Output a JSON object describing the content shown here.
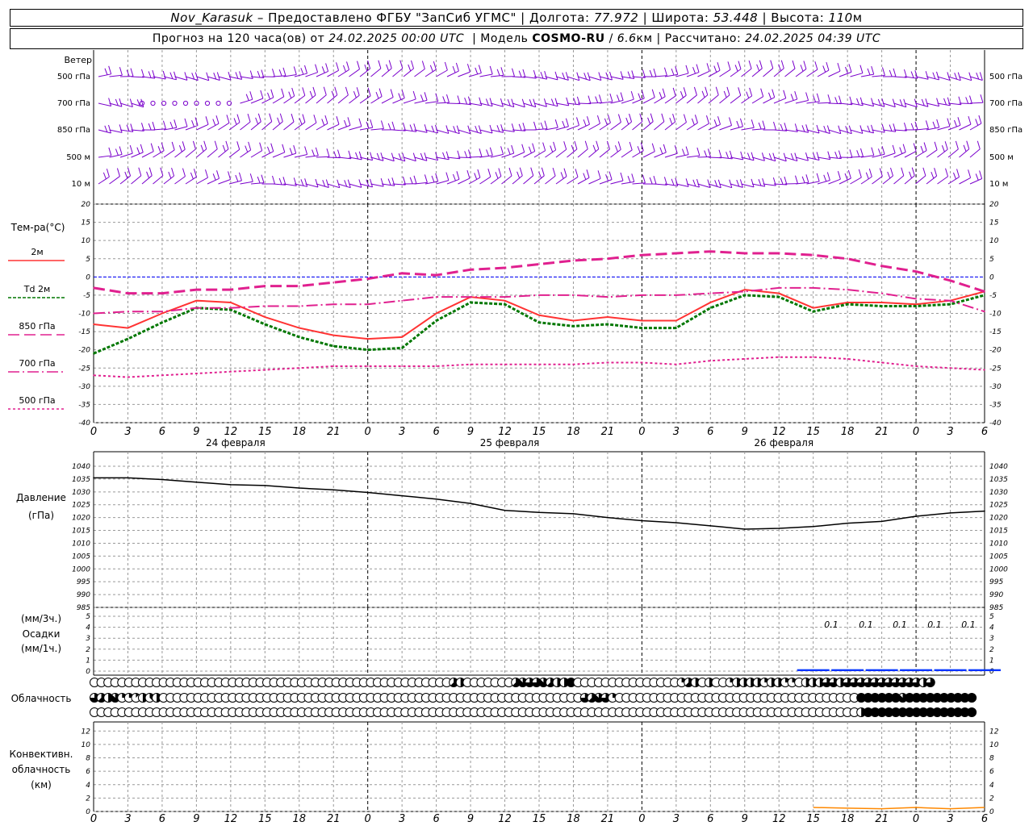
{
  "header": {
    "station": "Nov_Karasuk",
    "provided": "– Предоставлено ФГБУ \"ЗапСиб УГМС\"",
    "lon_label": "Долгота:",
    "lon": "77.972",
    "lat_label": "Широта:",
    "lat": "53.448",
    "alt_label": "Высота:",
    "alt": "110",
    "alt_unit": "м",
    "forecast_label": "Прогноз на 120 часа(ов) от",
    "forecast_time": "24.02.2025 00:00 UTC",
    "model_label": "Модель",
    "model": "COSMO-RU",
    "resolution": "6.6",
    "resolution_unit": "км",
    "computed_label": "Рассчитано:",
    "computed_time": "24.02.2025 04:39 UTC"
  },
  "wind_panel": {
    "title": "Ветер",
    "levels": [
      "500 гПа",
      "700 гПа",
      "850 гПа",
      "500 м",
      "10 м"
    ]
  },
  "temp_panel": {
    "title": "Тем-ра(°C)",
    "legend": [
      {
        "label": "2м",
        "color": "#ff3333",
        "dash": ""
      },
      {
        "label": "Td 2м",
        "color": "#007700",
        "dash": "4,2"
      },
      {
        "label": "850 гПа",
        "color": "#e0208f",
        "dash": "14,6"
      },
      {
        "label": "700 гПа",
        "color": "#e0208f",
        "dash": "14,4,2,4"
      },
      {
        "label": "500 гПа",
        "color": "#e0208f",
        "dash": "3,3"
      }
    ],
    "yticks": [
      "20",
      "15",
      "10",
      "5",
      "0",
      "-5",
      "-10",
      "-15",
      "-20",
      "-25",
      "-30",
      "-35",
      "-40"
    ]
  },
  "pressure_panel": {
    "title": "Давление",
    "unit": "(гПа)",
    "yticks": [
      "1040",
      "1035",
      "1030",
      "1025",
      "1020",
      "1015",
      "1010",
      "1005",
      "1000",
      "995",
      "990",
      "985"
    ]
  },
  "precip_panel": {
    "unit3": "(мм/3ч.)",
    "title": "Осадки",
    "unit1": "(мм/1ч.)",
    "yticks": [
      "5",
      "4",
      "3",
      "2",
      "1",
      "0"
    ],
    "labels": [
      "0.1",
      "0.1",
      "0.1",
      "0.1",
      "0.1"
    ]
  },
  "cloud_panel": {
    "title": "Облачность"
  },
  "conv_panel": {
    "title1": "Конвективн.",
    "title2": "облачность",
    "unit": "(км)",
    "yticks": [
      "12",
      "10",
      "8",
      "6",
      "4",
      "2",
      "0"
    ]
  },
  "time_axis": {
    "hour_labels": [
      "0",
      "3",
      "6",
      "9",
      "12",
      "15",
      "18",
      "21",
      "0",
      "3",
      "6",
      "9",
      "12",
      "15",
      "18",
      "21",
      "0",
      "3",
      "6",
      "9",
      "12",
      "15",
      "18",
      "21",
      "0",
      "3",
      "6"
    ],
    "dates": [
      "24 февраля",
      "25 февраля",
      "26 февраля"
    ]
  },
  "colors": {
    "wind": "#7a00cc",
    "zero_line": "#0000ff",
    "precip": "#0033ff",
    "conv": "#ff8800"
  },
  "chart_data": [
    {
      "type": "line",
      "title": "Тем-ра(°C)",
      "x_hours": [
        0,
        3,
        6,
        9,
        12,
        15,
        18,
        21,
        24,
        27,
        30,
        33,
        36,
        39,
        42,
        45,
        48,
        51,
        54,
        57,
        60,
        63,
        66,
        69,
        72,
        75,
        78
      ],
      "ylim": [
        -40,
        20
      ],
      "series": [
        {
          "name": "2м",
          "values": [
            -13,
            -14,
            -10,
            -6.5,
            -7,
            -11,
            -14,
            -16,
            -17,
            -16.5,
            -10,
            -5.5,
            -6.5,
            -10.5,
            -12,
            -11,
            -12,
            -12,
            -7,
            -3.5,
            -4.5,
            -8.5,
            -7,
            -7,
            -7.5,
            -6.5,
            -4
          ]
        },
        {
          "name": "Td 2м",
          "values": [
            -21,
            -17,
            -12.5,
            -8.5,
            -9,
            -13,
            -16.5,
            -19,
            -20,
            -19.5,
            -12,
            -7,
            -7.5,
            -12.5,
            -13.5,
            -13,
            -14,
            -14,
            -8.5,
            -5,
            -5.5,
            -9.5,
            -7.5,
            -8,
            -8,
            -7.5,
            -5
          ]
        },
        {
          "name": "850 гПа",
          "values": [
            -3,
            -4.5,
            -4.5,
            -3.5,
            -3.5,
            -2.5,
            -2.5,
            -1.5,
            -0.5,
            1,
            0.5,
            2,
            2.5,
            3.5,
            4.5,
            5,
            6,
            6.5,
            7,
            6.5,
            6.5,
            6,
            5,
            3,
            1.5,
            -1,
            -4
          ]
        },
        {
          "name": "700 гПа",
          "values": [
            -10,
            -9.5,
            -9.5,
            -8.5,
            -8.5,
            -8,
            -8,
            -7.5,
            -7.5,
            -6.5,
            -5.5,
            -5.5,
            -5.5,
            -5,
            -5,
            -5.5,
            -5,
            -5,
            -4.5,
            -4,
            -3,
            -3,
            -3.5,
            -4.5,
            -6,
            -6.5,
            -9.5
          ]
        },
        {
          "name": "500 гПа",
          "values": [
            -27,
            -27.5,
            -27,
            -26.5,
            -26,
            -25.5,
            -25,
            -24.5,
            -24.5,
            -24.5,
            -24.5,
            -24,
            -24,
            -24,
            -24,
            -23.5,
            -23.5,
            -24,
            -23,
            -22.5,
            -22,
            -22,
            -22.5,
            -23.5,
            -24.5,
            -25,
            -25.5
          ]
        }
      ]
    },
    {
      "type": "line",
      "title": "Давление",
      "x_hours": [
        0,
        3,
        6,
        9,
        12,
        15,
        18,
        21,
        24,
        27,
        30,
        33,
        36,
        39,
        42,
        45,
        48,
        51,
        54,
        57,
        60,
        63,
        66,
        69,
        72,
        75,
        78
      ],
      "ylim": [
        985,
        1040
      ],
      "series": [
        {
          "name": "",
          "values": [
            1035.5,
            1035.5,
            1034.8,
            1033.8,
            1032.8,
            1032.5,
            1031.5,
            1030.8,
            1029.8,
            1028.5,
            1027.2,
            1025.5,
            1022.8,
            1022,
            1021.5,
            1020,
            1018.8,
            1018,
            1016.8,
            1015.5,
            1015.8,
            1016.5,
            1017.8,
            1018.5,
            1020.5,
            1021.8,
            1022.5
          ]
        }
      ]
    },
    {
      "type": "bar",
      "title": "Осадки",
      "x_hours": [
        48,
        51,
        54,
        57,
        60,
        63,
        66,
        69,
        72,
        75,
        78
      ],
      "values": [
        0,
        0,
        0,
        0,
        0,
        0.1,
        0.1,
        0.1,
        0.1,
        0.1,
        0.1
      ],
      "ylim": [
        0,
        5
      ]
    },
    {
      "type": "area",
      "title": "Конвективн. облачность",
      "x_hours": [
        63,
        66,
        69,
        72,
        75,
        78
      ],
      "values": [
        0.6,
        0.5,
        0.4,
        0.6,
        0.4,
        0.6
      ],
      "ylim": [
        0,
        13
      ]
    },
    {
      "type": "table",
      "title": "Облачность",
      "rows": [
        {
          "level": "upper",
          "octas": [
            0,
            0,
            0,
            0,
            0,
            0,
            0,
            0,
            0,
            0,
            0,
            0,
            0,
            0,
            0,
            0,
            0,
            0,
            0,
            0,
            0,
            0,
            0,
            0,
            0,
            0,
            0,
            0,
            0,
            0,
            0,
            0,
            0,
            0,
            0,
            0,
            0,
            0,
            0,
            0,
            0,
            0,
            0,
            0,
            0,
            0,
            0,
            0,
            0,
            0,
            0,
            0,
            5,
            4,
            0,
            0,
            0,
            0,
            0,
            0,
            0,
            5,
            7,
            6,
            6,
            7,
            5,
            4,
            4,
            8,
            0,
            0,
            0,
            0,
            0,
            0,
            0,
            0,
            0,
            0,
            0,
            0,
            0,
            0,
            0,
            2,
            5,
            4,
            0,
            4,
            0,
            0,
            2,
            4,
            4,
            4,
            4,
            2,
            4,
            4,
            2,
            2,
            0,
            4,
            4,
            4,
            6,
            6,
            4,
            6,
            6,
            6,
            6,
            6,
            6,
            6,
            6,
            6,
            6,
            6,
            4,
            6
          ]
        },
        {
          "level": "middle",
          "octas": [
            6,
            5,
            4,
            7,
            2,
            2,
            1,
            4,
            3,
            4,
            0,
            0,
            0,
            0,
            0,
            0,
            0,
            0,
            0,
            0,
            0,
            0,
            0,
            0,
            0,
            0,
            0,
            0,
            0,
            0,
            0,
            0,
            0,
            0,
            0,
            0,
            0,
            0,
            0,
            0,
            0,
            0,
            0,
            0,
            0,
            0,
            0,
            0,
            0,
            0,
            0,
            0,
            0,
            0,
            0,
            0,
            0,
            0,
            0,
            0,
            0,
            0,
            0,
            0,
            0,
            0,
            0,
            0,
            0,
            0,
            0,
            6,
            5,
            7,
            6,
            2,
            0,
            0,
            0,
            0,
            0,
            0,
            0,
            0,
            0,
            0,
            0,
            0,
            0,
            0,
            0,
            0,
            0,
            0,
            0,
            0,
            0,
            0,
            0,
            0,
            0,
            0,
            0,
            0,
            0,
            0,
            0,
            0,
            0,
            0,
            0,
            8,
            8,
            8,
            8,
            8,
            8,
            7,
            8,
            8,
            8,
            8,
            8,
            8,
            8,
            8,
            8,
            8
          ]
        },
        {
          "level": "lower",
          "octas": [
            0,
            0,
            0,
            0,
            0,
            0,
            0,
            0,
            0,
            0,
            0,
            0,
            0,
            0,
            0,
            0,
            0,
            0,
            0,
            0,
            0,
            0,
            0,
            0,
            0,
            0,
            0,
            0,
            0,
            0,
            0,
            0,
            0,
            0,
            0,
            0,
            0,
            0,
            0,
            0,
            0,
            0,
            0,
            0,
            0,
            0,
            0,
            0,
            0,
            0,
            0,
            0,
            0,
            0,
            0,
            0,
            0,
            0,
            0,
            0,
            0,
            0,
            0,
            0,
            0,
            0,
            0,
            0,
            0,
            0,
            0,
            0,
            0,
            0,
            0,
            0,
            0,
            0,
            0,
            0,
            0,
            0,
            0,
            0,
            0,
            0,
            0,
            0,
            0,
            0,
            0,
            0,
            0,
            0,
            0,
            0,
            0,
            0,
            0,
            0,
            0,
            0,
            0,
            0,
            0,
            0,
            0,
            0,
            0,
            0,
            0,
            4,
            8,
            8,
            8,
            8,
            8,
            8,
            8,
            8,
            8,
            8,
            8,
            8,
            8,
            8,
            8,
            8
          ]
        }
      ]
    }
  ]
}
